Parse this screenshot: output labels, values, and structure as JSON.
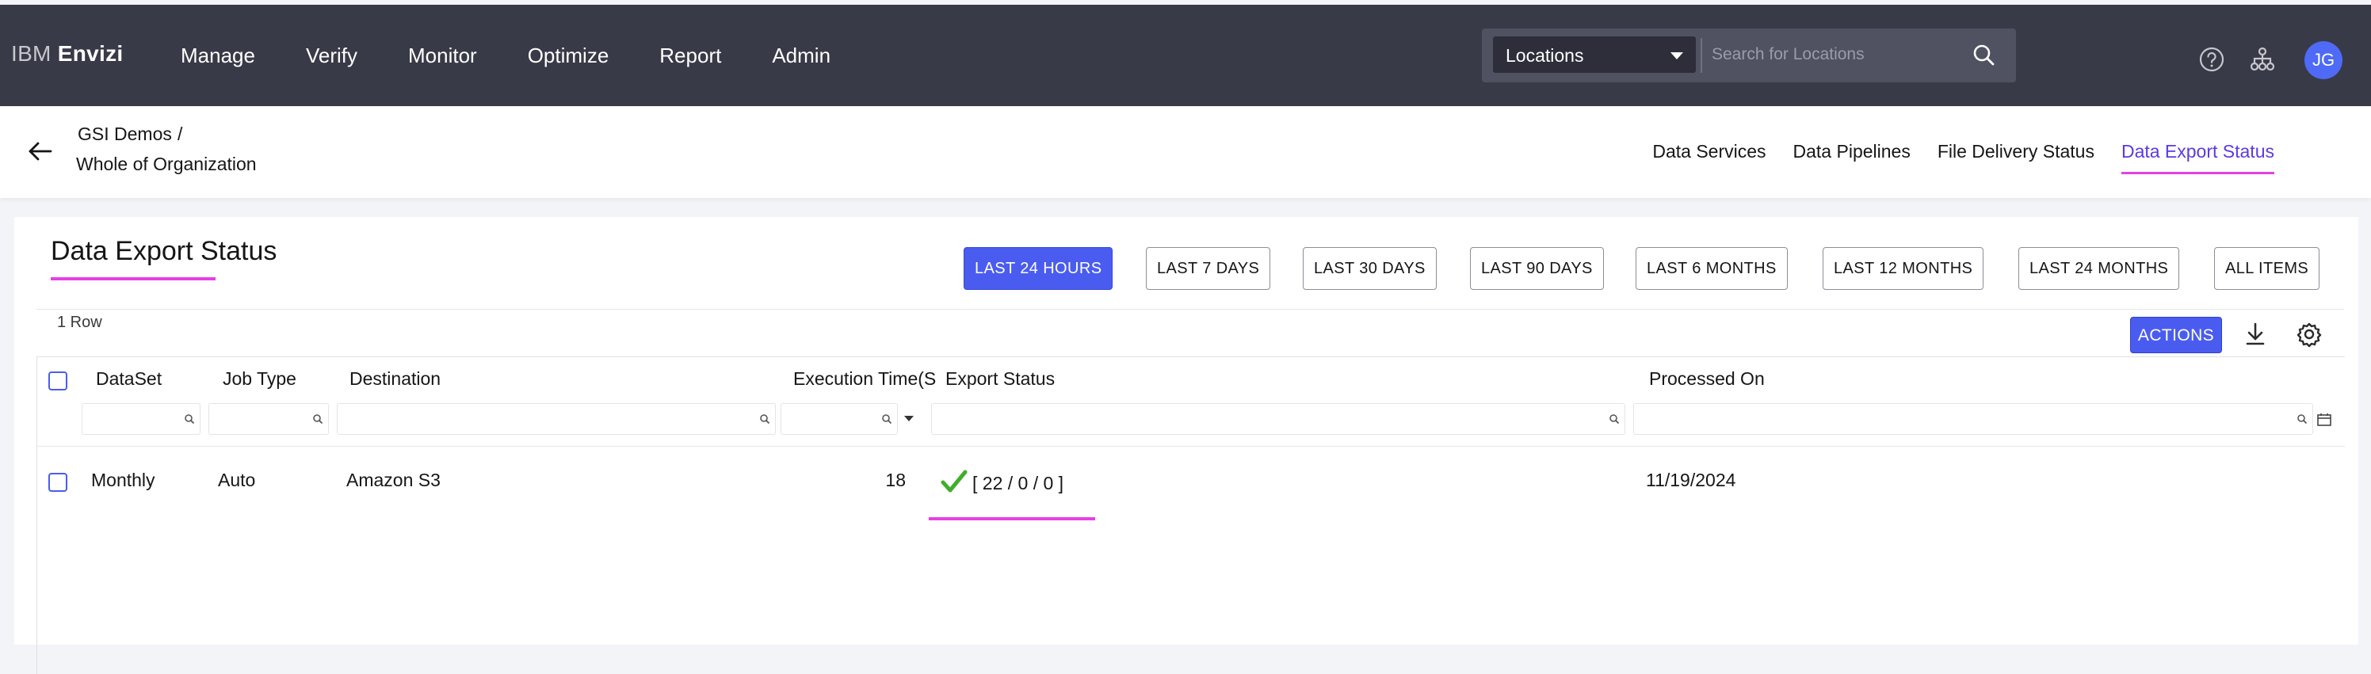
{
  "brand": {
    "prefix": "IBM",
    "name": "Envizi"
  },
  "nav": {
    "items": [
      "Manage",
      "Verify",
      "Monitor",
      "Optimize",
      "Report",
      "Admin"
    ]
  },
  "search": {
    "scope": "Locations",
    "placeholder": "Search for Locations"
  },
  "user": {
    "initials": "JG"
  },
  "breadcrumb": {
    "parent": "GSI Demos",
    "separator": "/",
    "current": "Whole of Organization"
  },
  "subtabs": {
    "items": [
      "Data Services",
      "Data Pipelines",
      "File Delivery Status",
      "Data Export Status"
    ],
    "active": "Data Export Status"
  },
  "page": {
    "title": "Data Export Status"
  },
  "ranges": {
    "items": [
      "LAST 24 HOURS",
      "LAST 7 DAYS",
      "LAST 30 DAYS",
      "LAST 90 DAYS",
      "LAST 6 MONTHS",
      "LAST 12 MONTHS",
      "LAST 24 MONTHS",
      "ALL ITEMS"
    ],
    "active": "LAST 24 HOURS"
  },
  "grid": {
    "row_count": "1 Row",
    "actions_label": "ACTIONS",
    "columns": [
      "DataSet",
      "Job Type",
      "Destination",
      "Execution Time(S",
      "Export Status",
      "Processed On"
    ],
    "rows": [
      {
        "dataset": "Monthly",
        "job_type": "Auto",
        "destination": "Amazon S3",
        "execution_time": "18",
        "export_status": "[ 22 / 0 / 0 ]",
        "processed_on": "11/19/2024"
      }
    ]
  },
  "colors": {
    "topbar": "#393a48",
    "accent": "#4a5cf0",
    "highlight": "#e540e4",
    "success": "#3fae2a",
    "avatar": "#4e6af6"
  }
}
